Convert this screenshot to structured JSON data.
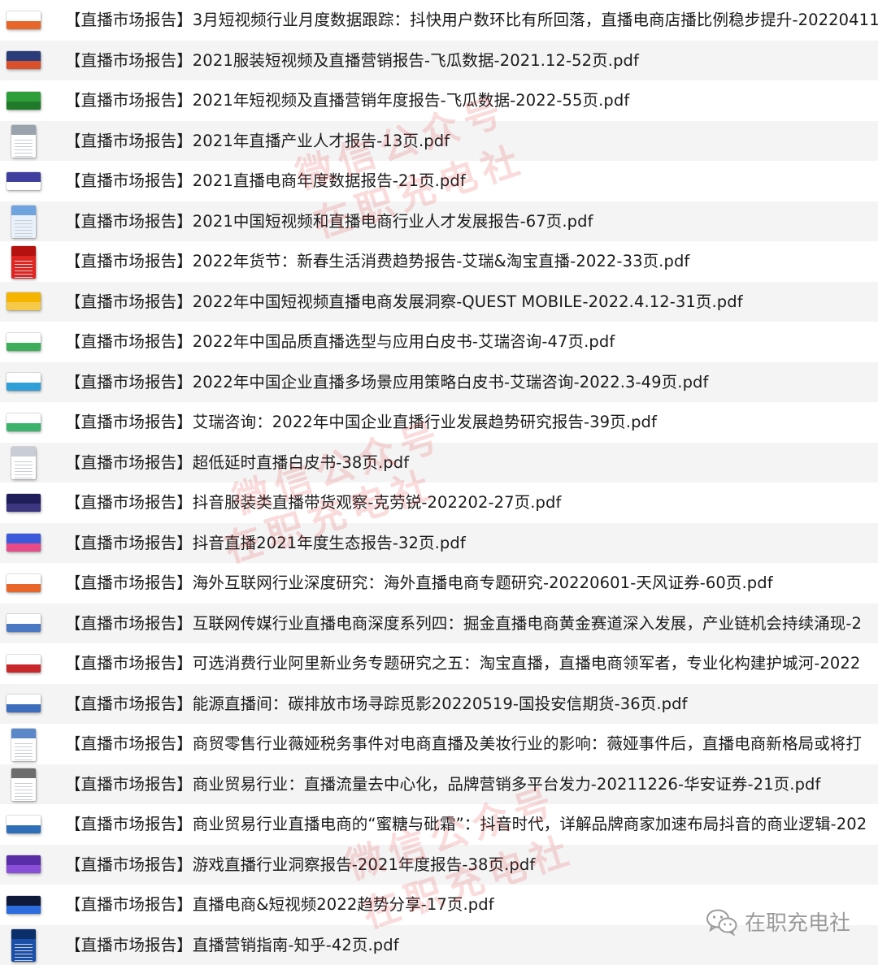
{
  "files": [
    {
      "name": "【直播市场报告】3月短视频行业月度数据跟踪：抖快用户数环比有所回落，直播电商店播比例稳步提升-20220411",
      "thumb": "land",
      "colors": [
        "#ffffff",
        "#e8662a"
      ]
    },
    {
      "name": "【直播市场报告】2021服装短视频及直播营销报告-飞瓜数据-2021.12-52页.pdf",
      "thumb": "land",
      "colors": [
        "#2a3d7a",
        "#d9502b"
      ]
    },
    {
      "name": "【直播市场报告】2021年短视频及直播营销年度报告-飞瓜数据-2022-55页.pdf",
      "thumb": "land",
      "colors": [
        "#2e9e3a",
        "#1f7a2a"
      ]
    },
    {
      "name": "【直播市场报告】2021年直播产业人才报告-13页.pdf",
      "thumb": "port",
      "colors": [
        "#ffffff",
        "#9aa3ad"
      ]
    },
    {
      "name": "【直播市场报告】2021直播电商年度数据报告-21页.pdf",
      "thumb": "land",
      "colors": [
        "#3f3f9f",
        "#ffffff"
      ]
    },
    {
      "name": "【直播市场报告】2021中国短视频和直播电商行业人才发展报告-67页.pdf",
      "thumb": "port",
      "colors": [
        "#e9f1fb",
        "#6fa4df"
      ]
    },
    {
      "name": "【直播市场报告】2022年货节：新春生活消费趋势报告-艾瑞&淘宝直播-2022-33页.pdf",
      "thumb": "port",
      "colors": [
        "#e0241f",
        "#b5120f"
      ]
    },
    {
      "name": "【直播市场报告】2022年中国短视频直播电商发展洞察-QUEST MOBILE-2022.4.12-31页.pdf",
      "thumb": "land",
      "colors": [
        "#f4b400",
        "#f7c948"
      ]
    },
    {
      "name": "【直播市场报告】2022年中国品质直播选型与应用白皮书-艾瑞咨询-47页.pdf",
      "thumb": "land",
      "colors": [
        "#ffffff",
        "#3fae5a"
      ]
    },
    {
      "name": "【直播市场报告】2022年中国企业直播多场景应用策略白皮书-艾瑞咨询-2022.3-49页.pdf",
      "thumb": "land",
      "colors": [
        "#ffffff",
        "#2f9fd8"
      ]
    },
    {
      "name": "【直播市场报告】艾瑞咨询：2022年中国企业直播行业发展趋势研究报告-39页.pdf",
      "thumb": "land",
      "colors": [
        "#ffffff",
        "#3bb36a"
      ]
    },
    {
      "name": "【直播市场报告】超低延时直播白皮书-38页.pdf",
      "thumb": "port",
      "colors": [
        "#ffffff",
        "#c9ced6"
      ]
    },
    {
      "name": "【直播市场报告】抖音服装类直播带货观察-克劳锐-202202-27页.pdf",
      "thumb": "land",
      "colors": [
        "#1f1d5a",
        "#3a3680"
      ]
    },
    {
      "name": "【直播市场报告】抖音直播2021年度生态报告-32页.pdf",
      "thumb": "land",
      "colors": [
        "#3b5bdb",
        "#e84a8a"
      ]
    },
    {
      "name": "【直播市场报告】海外互联网行业深度研究：海外直播电商专题研究-20220601-天风证券-60页.pdf",
      "thumb": "land",
      "colors": [
        "#ffffff",
        "#e8662a"
      ]
    },
    {
      "name": "【直播市场报告】互联网传媒行业直播电商深度系列四：掘金直播电商黄金赛道深入发展，产业链机会持续涌现-2",
      "thumb": "land",
      "colors": [
        "#ffffff",
        "#4a78c2"
      ]
    },
    {
      "name": "【直播市场报告】可选消费行业阿里新业务专题研究之五：淘宝直播，直播电商领军者，专业化构建护城河-2022",
      "thumb": "land",
      "colors": [
        "#ffffff",
        "#c8282c"
      ]
    },
    {
      "name": "【直播市场报告】能源直播间：碳排放市场寻踪觅影20220519-国投安信期货-36页.pdf",
      "thumb": "land",
      "colors": [
        "#ffffff",
        "#3c6ebd"
      ]
    },
    {
      "name": "【直播市场报告】商贸零售行业薇娅税务事件对电商直播及美妆行业的影响：薇娅事件后，直播电商新格局或将打",
      "thumb": "port",
      "colors": [
        "#ffffff",
        "#5a88c8"
      ]
    },
    {
      "name": "【直播市场报告】商业贸易行业：直播流量去中心化，品牌营销多平台发力-20211226-华安证券-21页.pdf",
      "thumb": "port",
      "colors": [
        "#ffffff",
        "#6d6d6d"
      ]
    },
    {
      "name": "【直播市场报告】商业贸易行业直播电商的“蜜糖与砒霜”：抖音时代，详解品牌商家加速布局抖音的商业逻辑-202",
      "thumb": "land",
      "colors": [
        "#ffffff",
        "#2f6fb8"
      ]
    },
    {
      "name": "【直播市场报告】游戏直播行业洞察报告-2021年度报告-38页.pdf",
      "thumb": "land",
      "colors": [
        "#5b2ca8",
        "#8a4fd8"
      ]
    },
    {
      "name": "【直播市场报告】直播电商&短视频2022趋势分享-17页.pdf",
      "thumb": "land",
      "colors": [
        "#0f1a3a",
        "#2d6cdf"
      ]
    },
    {
      "name": "【直播市场报告】直播营销指南-知乎-42页.pdf",
      "thumb": "port",
      "colors": [
        "#1a4fa8",
        "#0b2f6b"
      ]
    }
  ],
  "watermarks": [
    {
      "text": "微信公众号"
    },
    {
      "text": "在职充电社"
    },
    {
      "text": "微信公众号"
    },
    {
      "text": "在职充电社"
    },
    {
      "text": "微信公众号"
    },
    {
      "text": "在职充电社"
    }
  ],
  "brand": {
    "text": "在职充电社",
    "icon": "wechat-icon"
  }
}
